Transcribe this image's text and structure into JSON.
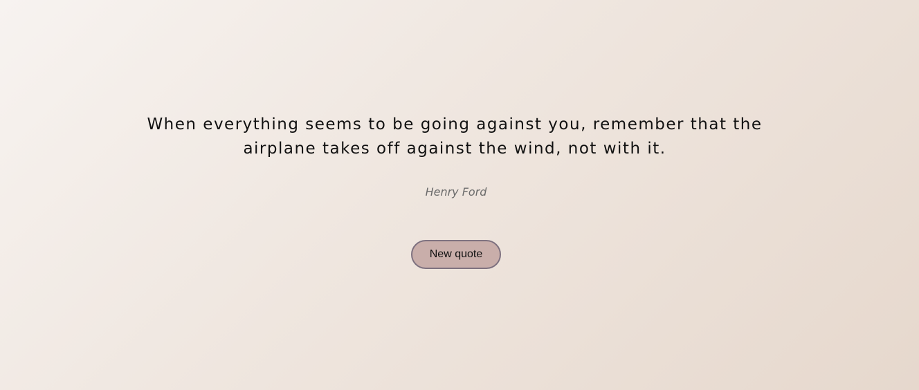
{
  "quote": {
    "text": "When everything seems to be going against you, remember that the airplane takes off against the wind, not with it.",
    "author": "Henry Ford"
  },
  "actions": {
    "new_quote_label": "New quote"
  },
  "colors": {
    "button_background": "#c9aeaa",
    "button_border": "#7f7280",
    "quote_text": "#111111",
    "author_text": "#6b6b6b"
  }
}
